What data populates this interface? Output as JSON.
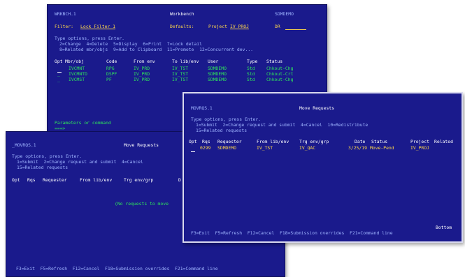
{
  "workbench": {
    "screen_id": "WRKBCH.1",
    "title": "Workbench",
    "user": "SDMDEMO",
    "filter_label": "Filter:",
    "filter_value": "Lock Filter 1",
    "defaults_label": "Defaults:",
    "project_label": "Project",
    "project_value": "IV_PROJ",
    "dr_label": "DR",
    "instructions": "Type options, press Enter.",
    "options_line1": "2=Change  4=Delete  5=Display  6=Print  7=Lock detail",
    "options_line2": "8=Related mbr/objs  9=Add to Clipboard  11=Promote  12=Concurrent dev...",
    "headers": {
      "opt": "Opt",
      "mbr": "Mbr/obj",
      "code": "Code",
      "from": "From env",
      "to": "To lib/env",
      "user": "User",
      "type": "Type",
      "status": "Status"
    },
    "rows": [
      {
        "mbr": "IVCMNT",
        "code": "RPG",
        "from": "IV_PRD",
        "to": "IV_TST",
        "user": "SDMDEMO",
        "type": "Std",
        "status": "Chkout-Chg"
      },
      {
        "mbr": "IVCMNTD",
        "code": "DSPF",
        "from": "IV_PRD",
        "to": "IV_TST",
        "user": "SDMDEMO",
        "type": "Std",
        "status": "Chkout-Crt"
      },
      {
        "mbr": "IVCMST",
        "code": "PF",
        "from": "IV_PRD",
        "to": "IV_TST",
        "user": "SDMDEMO",
        "type": "Std",
        "status": "Chkout-Chg"
      }
    ],
    "params_label": "Parameters or command",
    "prompt": "===>"
  },
  "move_empty": {
    "screen_id": "_MOVRQS.1",
    "title": "Move Requests",
    "instructions": "Type options, press Enter.",
    "options_line1": "1=Submit  2=Change request and submit  4=Cancel",
    "options_line2": "15=Related requests",
    "headers": {
      "opt": "Opt",
      "rqs": "Rqs",
      "requester": "Requester",
      "from": "From lib/env",
      "trg": "Trg env/grp",
      "d": "D"
    },
    "empty_message": "(No requests to move",
    "fkeys": "F3=Exit  F5=Refresh  F12=Cancel  F18=Submission overrides  F21=Command line"
  },
  "move_list": {
    "screen_id": "MOVRQS.1",
    "title": "Move Requests",
    "instructions": "Type options, press Enter.",
    "options_line1": "1=Submit  2=Change request and submit  4=Cancel  10=Redistribute",
    "options_line2": "15=Related requests",
    "headers": {
      "opt": "Opt",
      "rqs": "Rqs",
      "requester": "Requester",
      "from": "From lib/env",
      "trg": "Trg env/grp",
      "date": "Date",
      "status": "Status",
      "project": "Project",
      "related": "Related"
    },
    "rows": [
      {
        "rqs": "0299",
        "requester": "SDMDEMO",
        "from": "IV_TST",
        "trg": "IV_QAC",
        "date": "3/25/19",
        "status": "Move-Pend",
        "project": "IV_PROJ"
      }
    ],
    "bottom": "Bottom",
    "fkeys": "F3=Exit  F5=Refresh  F12=Cancel  F18=Submission overrides  F21=Command line"
  },
  "colors": {
    "screen_bg": "#1a1a8c",
    "text_blue": "#9fb4ff",
    "text_white": "#ffffff",
    "text_yellow": "#ffd84a",
    "text_green": "#2ee65a"
  }
}
